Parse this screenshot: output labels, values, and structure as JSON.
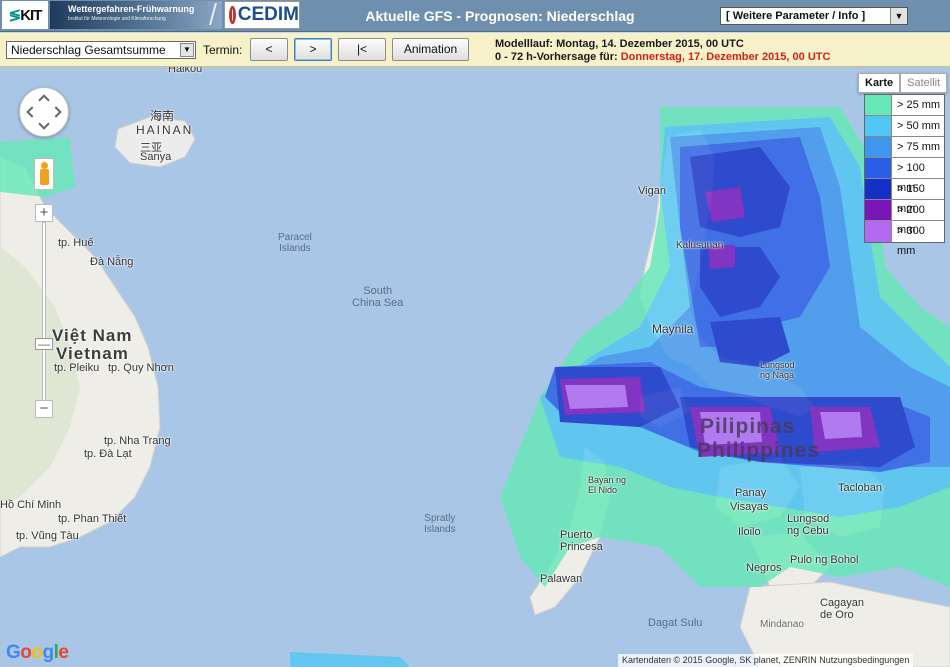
{
  "header": {
    "kit_logo": "KIT",
    "wfw_title": "Wettergefahren-Frühwarnung",
    "wfw_subtitle": "Institut für Meteorologie und Klimaforschung",
    "cedim_logo": "CEDIM",
    "title": "Aktuelle GFS - Prognosen: Niederschlag",
    "param_select": "[ Weitere Parameter / Info ]"
  },
  "controls": {
    "type_select": "Niederschlag Gesamtsumme",
    "termin_label": "Termin:",
    "prev_label": "<",
    "next_label": ">",
    "first_label": "|<",
    "animation_label": "Animation",
    "run_line1": "Modelllauf: Montag, 14. Dezember 2015, 00 UTC",
    "run_line2_prefix": "0 - 72 h-Vorhersage für:",
    "run_line2_date": "Donnerstag, 17. Dezember 2015, 00 UTC"
  },
  "map": {
    "places": {
      "haikou": "Haikou",
      "hainan_cn": "海南",
      "hainan": "HAINAN",
      "sanya_cn": "三亚",
      "sanya": "Sanya",
      "paracel": "Paracel\nIslands",
      "hue": "tp. Huế",
      "danang": "Đà Nẵng",
      "southchinasea": "South\nChina Sea",
      "vietnam1": "Việt Nam",
      "vietnam2": "Vietnam",
      "pleiku": "tp. Pleiku",
      "quynhon": "tp. Quy Nhơn",
      "nhatrang": "tp. Nha Trang",
      "dalat": "tp. Đà Lạt",
      "hochiminh": "Hồ Chí Minh",
      "phanthiet": "tp. Phan Thiết",
      "vungtau": "tp. Vũng Tàu",
      "spratly": "Spratly\nIslands",
      "vigan": "Vigan",
      "kalusunan": "Kalusunan",
      "maynila": "Maynila",
      "lungsod_naga": "Lungsod\nng Naga",
      "pilipinas": "Pilipinas",
      "philippines": "Philippines",
      "bayan_nido": "Bayan ng\nEl Nido",
      "puerto_princesa": "Puerto\nPrincesa",
      "palawan": "Palawan",
      "panay": "Panay",
      "visayas": "Visayas",
      "iloilo": "Iloilo",
      "lungsod_cebu": "Lungsod\nng Cebu",
      "negros": "Negros",
      "pulo_bohol": "Pulo ng Bohol",
      "tacloban": "Tacloban",
      "cagayan": "Cagayan\nde Oro",
      "dagat_sulu": "Dagat Sulu",
      "mindanao": "Mindanao"
    },
    "maptype": {
      "karte": "Karte",
      "satellit": "Satellit"
    },
    "legend": [
      {
        "label": "> 25 mm",
        "color": "#66e8b8"
      },
      {
        "label": "> 50 mm",
        "color": "#52c6f2"
      },
      {
        "label": "> 75 mm",
        "color": "#3f96ee"
      },
      {
        "label": "> 100 mm",
        "color": "#2a5ee6"
      },
      {
        "label": "> 150 mm",
        "color": "#1430c8"
      },
      {
        "label": "> 200 mm",
        "color": "#7a16b8"
      },
      {
        "label": "> 300 mm",
        "color": "#b36af0"
      }
    ],
    "zoom_in": "+",
    "zoom_out": "−",
    "zoom_thumb": "—",
    "google": {
      "g1": "G",
      "o1": "o",
      "o2": "o",
      "g2": "g",
      "l": "l",
      "e": "e"
    },
    "credits": "Kartendaten © 2015 Google, SK planet, ZENRIN   Nutzungsbedingungen"
  }
}
